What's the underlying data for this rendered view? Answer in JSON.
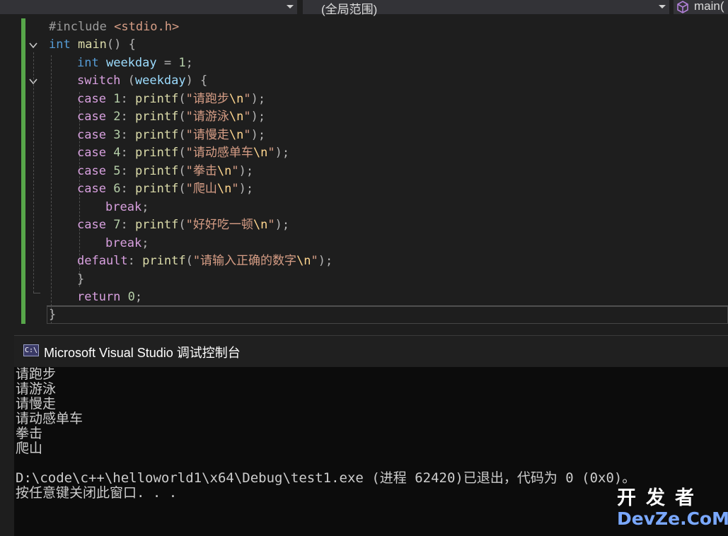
{
  "navbar": {
    "scope": "(全局范围)",
    "function": "main("
  },
  "editor": {
    "lines": [
      [
        {
          "t": "#include ",
          "c": "pre"
        },
        {
          "t": "<stdio.h>",
          "c": "inc"
        }
      ],
      [
        {
          "t": "int",
          "c": "kw"
        },
        {
          "t": " ",
          "c": "pun"
        },
        {
          "t": "main",
          "c": "fn"
        },
        {
          "t": "() {",
          "c": "pun"
        }
      ],
      [
        {
          "t": "int",
          "c": "kw"
        },
        {
          "t": " ",
          "c": "pun"
        },
        {
          "t": "weekday",
          "c": "var"
        },
        {
          "t": " = ",
          "c": "pun"
        },
        {
          "t": "1",
          "c": "num"
        },
        {
          "t": ";",
          "c": "pun"
        }
      ],
      [
        {
          "t": "switch",
          "c": "ctl"
        },
        {
          "t": " (",
          "c": "pun"
        },
        {
          "t": "weekday",
          "c": "var"
        },
        {
          "t": ") {",
          "c": "pun"
        }
      ],
      [
        {
          "t": "case",
          "c": "ctl"
        },
        {
          "t": " ",
          "c": "pun"
        },
        {
          "t": "1",
          "c": "num"
        },
        {
          "t": ": ",
          "c": "pun"
        },
        {
          "t": "printf",
          "c": "fn"
        },
        {
          "t": "(",
          "c": "pun"
        },
        {
          "t": "\"请跑步",
          "c": "str"
        },
        {
          "t": "\\n",
          "c": "esc"
        },
        {
          "t": "\"",
          "c": "str"
        },
        {
          "t": ");",
          "c": "pun"
        }
      ],
      [
        {
          "t": "case",
          "c": "ctl"
        },
        {
          "t": " ",
          "c": "pun"
        },
        {
          "t": "2",
          "c": "num"
        },
        {
          "t": ": ",
          "c": "pun"
        },
        {
          "t": "printf",
          "c": "fn"
        },
        {
          "t": "(",
          "c": "pun"
        },
        {
          "t": "\"请游泳",
          "c": "str"
        },
        {
          "t": "\\n",
          "c": "esc"
        },
        {
          "t": "\"",
          "c": "str"
        },
        {
          "t": ");",
          "c": "pun"
        }
      ],
      [
        {
          "t": "case",
          "c": "ctl"
        },
        {
          "t": " ",
          "c": "pun"
        },
        {
          "t": "3",
          "c": "num"
        },
        {
          "t": ": ",
          "c": "pun"
        },
        {
          "t": "printf",
          "c": "fn"
        },
        {
          "t": "(",
          "c": "pun"
        },
        {
          "t": "\"请慢走",
          "c": "str"
        },
        {
          "t": "\\n",
          "c": "esc"
        },
        {
          "t": "\"",
          "c": "str"
        },
        {
          "t": ");",
          "c": "pun"
        }
      ],
      [
        {
          "t": "case",
          "c": "ctl"
        },
        {
          "t": " ",
          "c": "pun"
        },
        {
          "t": "4",
          "c": "num"
        },
        {
          "t": ": ",
          "c": "pun"
        },
        {
          "t": "printf",
          "c": "fn"
        },
        {
          "t": "(",
          "c": "pun"
        },
        {
          "t": "\"请动感单车",
          "c": "str"
        },
        {
          "t": "\\n",
          "c": "esc"
        },
        {
          "t": "\"",
          "c": "str"
        },
        {
          "t": ");",
          "c": "pun"
        }
      ],
      [
        {
          "t": "case",
          "c": "ctl"
        },
        {
          "t": " ",
          "c": "pun"
        },
        {
          "t": "5",
          "c": "num"
        },
        {
          "t": ": ",
          "c": "pun"
        },
        {
          "t": "printf",
          "c": "fn"
        },
        {
          "t": "(",
          "c": "pun"
        },
        {
          "t": "\"拳击",
          "c": "str"
        },
        {
          "t": "\\n",
          "c": "esc"
        },
        {
          "t": "\"",
          "c": "str"
        },
        {
          "t": ");",
          "c": "pun"
        }
      ],
      [
        {
          "t": "case",
          "c": "ctl"
        },
        {
          "t": " ",
          "c": "pun"
        },
        {
          "t": "6",
          "c": "num"
        },
        {
          "t": ": ",
          "c": "pun"
        },
        {
          "t": "printf",
          "c": "fn"
        },
        {
          "t": "(",
          "c": "pun"
        },
        {
          "t": "\"爬山",
          "c": "str"
        },
        {
          "t": "\\n",
          "c": "esc"
        },
        {
          "t": "\"",
          "c": "str"
        },
        {
          "t": ");",
          "c": "pun"
        }
      ],
      [
        {
          "t": "break",
          "c": "ctl"
        },
        {
          "t": ";",
          "c": "pun"
        }
      ],
      [
        {
          "t": "case",
          "c": "ctl"
        },
        {
          "t": " ",
          "c": "pun"
        },
        {
          "t": "7",
          "c": "num"
        },
        {
          "t": ": ",
          "c": "pun"
        },
        {
          "t": "printf",
          "c": "fn"
        },
        {
          "t": "(",
          "c": "pun"
        },
        {
          "t": "\"好好吃一顿",
          "c": "str"
        },
        {
          "t": "\\n",
          "c": "esc"
        },
        {
          "t": "\"",
          "c": "str"
        },
        {
          "t": ");",
          "c": "pun"
        }
      ],
      [
        {
          "t": "break",
          "c": "ctl"
        },
        {
          "t": ";",
          "c": "pun"
        }
      ],
      [
        {
          "t": "default",
          "c": "ctl"
        },
        {
          "t": ": ",
          "c": "pun"
        },
        {
          "t": "printf",
          "c": "fn"
        },
        {
          "t": "(",
          "c": "pun"
        },
        {
          "t": "\"请输入正确的数字",
          "c": "str"
        },
        {
          "t": "\\n",
          "c": "esc"
        },
        {
          "t": "\"",
          "c": "str"
        },
        {
          "t": ");",
          "c": "pun"
        }
      ],
      [
        {
          "t": "}",
          "c": "pun"
        }
      ],
      [
        {
          "t": "return",
          "c": "ctl"
        },
        {
          "t": " ",
          "c": "pun"
        },
        {
          "t": "0",
          "c": "num"
        },
        {
          "t": ";",
          "c": "pun"
        }
      ],
      [
        {
          "t": "}",
          "c": "pun"
        }
      ]
    ]
  },
  "console": {
    "title": "Microsoft Visual Studio 调试控制台",
    "icon_text": "C:\\",
    "output": [
      "请跑步",
      "请游泳",
      "请慢走",
      "请动感单车",
      "拳击",
      "爬山",
      "",
      "D:\\code\\c++\\helloworld1\\x64\\Debug\\test1.exe (进程 62420)已退出，代码为 0 (0x0)。",
      "按任意键关闭此窗口. . ."
    ]
  },
  "watermark": {
    "top": "开发者",
    "bottom": "DevZe.CoM"
  }
}
